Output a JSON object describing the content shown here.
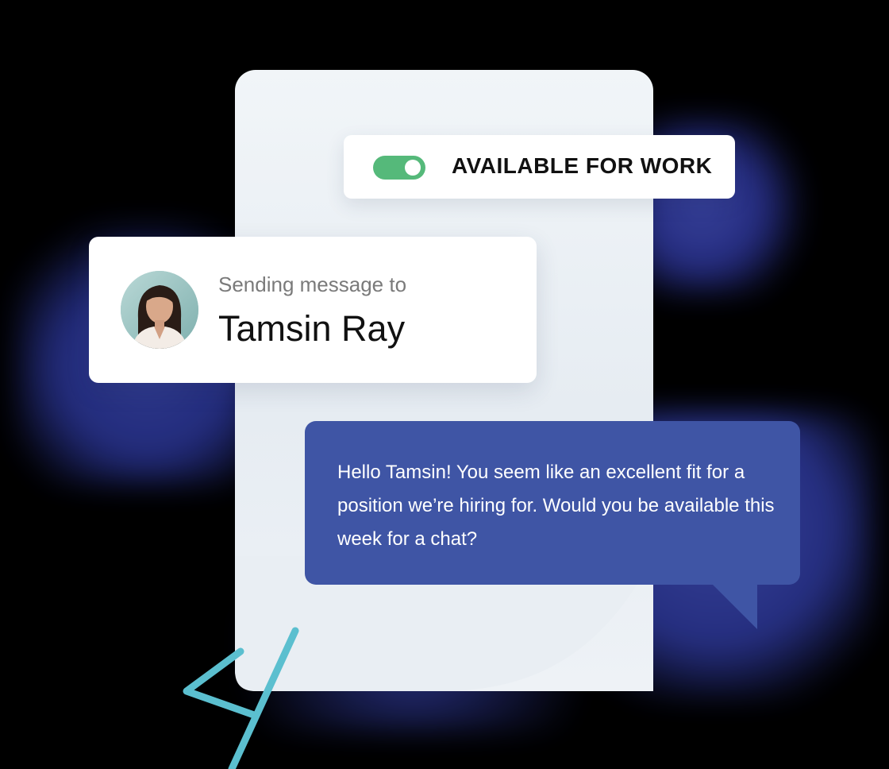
{
  "status": {
    "label": "AVAILABLE FOR WORK",
    "toggle_on": true,
    "toggle_color": "#55b97a"
  },
  "recipient": {
    "prefix": "Sending message to",
    "name": "Tamsin Ray",
    "avatar_icon": "person-avatar"
  },
  "message": {
    "text": "Hello Tamsin! You seem like an excellent fit for a position we’re hiring for. Would you be available this week for a chat?"
  },
  "colors": {
    "bubble": "#3f55a5",
    "accent_teal": "#5bbfcf",
    "glow": "#2f3a98"
  },
  "decoration": {
    "icon": "code-bracket-icon"
  }
}
